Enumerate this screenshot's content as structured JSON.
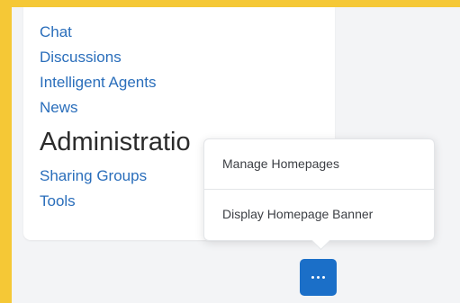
{
  "panel": {
    "links": [
      "Chat",
      "Discussions",
      "Intelligent Agents",
      "News"
    ],
    "section_heading": "Administratio",
    "admin_links": [
      "Sharing Groups",
      "Tools"
    ]
  },
  "menu": {
    "items": [
      "Manage Homepages",
      "Display Homepage Banner"
    ]
  },
  "more_button": {
    "icon": "more-horizontal-icon"
  },
  "colors": {
    "frame": "#f5c836",
    "canvas": "#f3f4f6",
    "link": "#2a6ebb",
    "primary_button": "#1b6fc8"
  }
}
